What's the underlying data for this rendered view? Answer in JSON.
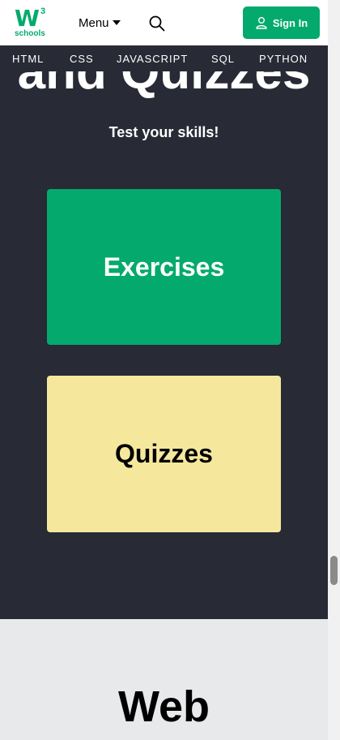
{
  "header": {
    "logo": {
      "mark": "W",
      "superscript": "3",
      "subtitle": "schools"
    },
    "menu_label": "Menu",
    "search_icon": "search-icon",
    "signin_label": "Sign In",
    "signin_icon": "user-icon"
  },
  "nav": {
    "items": [
      "HTML",
      "CSS",
      "JAVASCRIPT",
      "SQL",
      "PYTHON"
    ]
  },
  "section": {
    "heading_partial": "and Quizzes",
    "tagline": "Test your skills!",
    "exercises_label": "Exercises",
    "quizzes_label": "Quizzes"
  },
  "next_section": {
    "heading": "Web"
  },
  "colors": {
    "brand_green": "#04AA6D",
    "dark_bg": "#282A35",
    "quiz_yellow": "#F5E89D",
    "light_bg": "#E7E9EB"
  }
}
